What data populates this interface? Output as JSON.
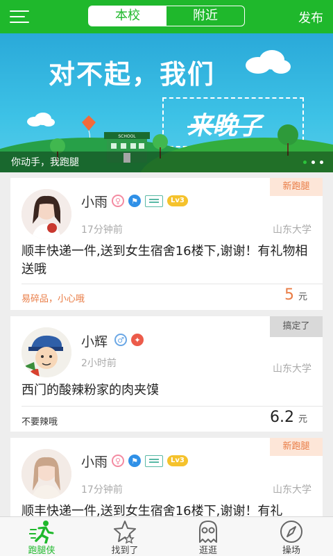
{
  "header": {
    "tabs": [
      {
        "label": "本校",
        "active": true
      },
      {
        "label": "附近",
        "active": false
      }
    ],
    "publish_label": "发布"
  },
  "banner": {
    "title": "对不起，我们",
    "boxed_text": "来晚了",
    "sign_text": "SCHOOL",
    "caption": "你动手，我跑腿",
    "slide_count": 3,
    "active_slide": 0
  },
  "posts": [
    {
      "name": "小雨",
      "gender": "female",
      "level": "Lv3",
      "time": "17分钟前",
      "school": "山东大学",
      "content": "顺丰快递一件,送到女生宿舍16楼下,谢谢！有礼物相送哦",
      "note": "易碎品，小心哦",
      "price": "5",
      "unit": "元",
      "tag": "新跑腿"
    },
    {
      "name": "小辉",
      "gender": "male",
      "time": "2小时前",
      "school": "山东大学",
      "content": "西门的酸辣粉家的肉夹馍",
      "note": "不要辣哦",
      "price": "6.2",
      "unit": "元",
      "tag": "搞定了"
    },
    {
      "name": "小雨",
      "gender": "female",
      "level": "Lv3",
      "time": "17分钟前",
      "school": "山东大学",
      "content": "顺丰快递一件,送到女生宿舍16楼下,谢谢！有礼",
      "tag": "新跑腿"
    }
  ],
  "nav": [
    {
      "label": "跑腿侠",
      "icon": "runner-icon",
      "active": true
    },
    {
      "label": "找到了",
      "icon": "star-icon",
      "active": false
    },
    {
      "label": "逛逛",
      "icon": "ghost-icon",
      "active": false
    },
    {
      "label": "操场",
      "icon": "compass-icon",
      "active": false
    }
  ],
  "colors": {
    "primary_green": "#1fb82c",
    "new_tag_bg": "#fde6d8",
    "new_tag_text": "#e97c45",
    "done_tag_bg": "#d9d9d9",
    "price_note_orange": "#e97c45"
  }
}
